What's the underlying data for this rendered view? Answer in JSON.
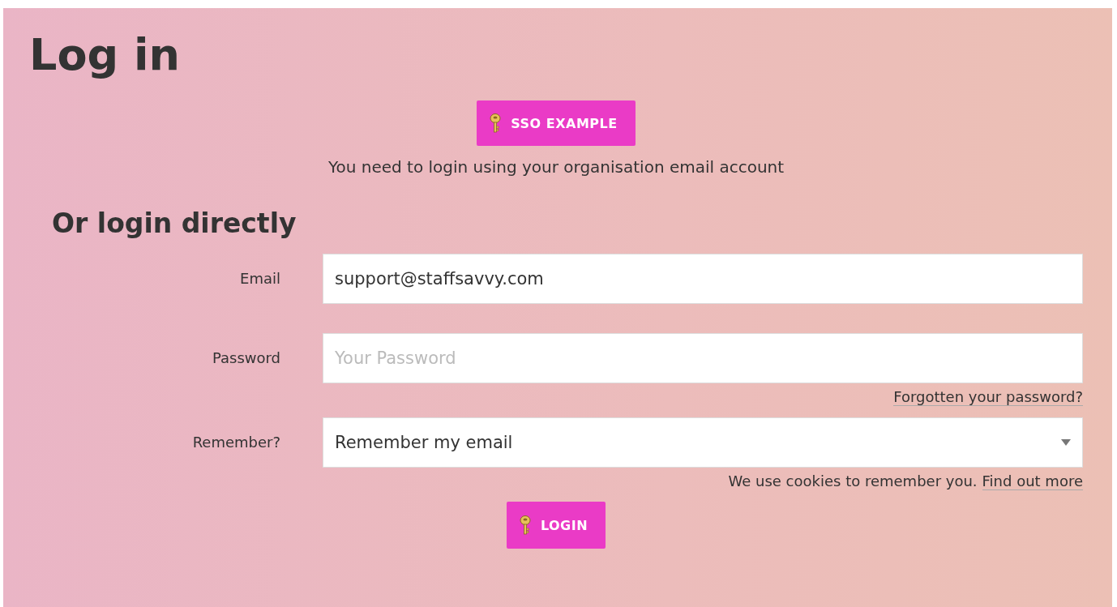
{
  "title": "Log in",
  "sso_button": {
    "label": "SSO EXAMPLE"
  },
  "sso_note": "You need to login using your organisation email account",
  "section_title": "Or login directly",
  "fields": [
    {
      "kind": "text",
      "label": "Email",
      "value": "support@staffsavvy.com"
    },
    {
      "kind": "password",
      "label": "Password",
      "placeholder": "Your Password",
      "help_link": "Forgotten your password?"
    },
    {
      "kind": "select",
      "label": "Remember?",
      "value": "Remember my email",
      "help_text": "We use cookies to remember you.",
      "help_link": "Find out more"
    }
  ],
  "login_button": {
    "label": "LOGIN"
  }
}
